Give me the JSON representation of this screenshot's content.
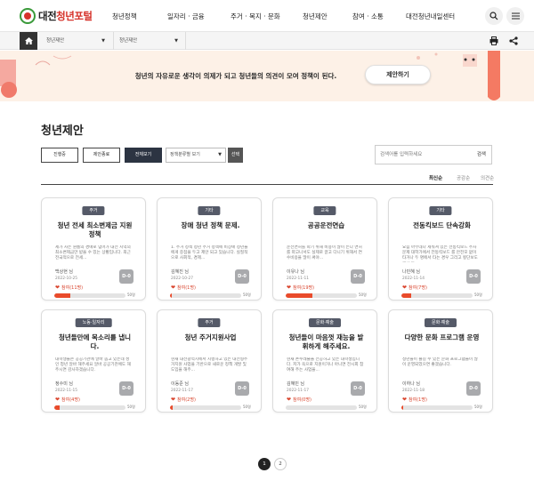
{
  "header": {
    "logo_prefix": "대전",
    "logo_main": "청년포털",
    "nav": [
      "청년정책",
      "일자리 · 금융",
      "주거 · 복지 · 문화",
      "청년제안",
      "참여 · 소통",
      "대전청년내일센터"
    ]
  },
  "breadcrumb": {
    "level1": "청년제안",
    "level2": "청년제안"
  },
  "banner": {
    "text": "청년의 자유로운 생각이 의제가 되고 청년들의 의견이 모여 정책이 된다.",
    "button_label": "제안하기"
  },
  "page_title": "청년제안",
  "filters": {
    "in_progress": "진행중",
    "closed": "제안종료",
    "view_all": "전체보기",
    "policy_select": "정책분류별 보기",
    "select_btn": "선택"
  },
  "search": {
    "placeholder": "검색어를 입력하세요",
    "button": "검색"
  },
  "sort": {
    "latest": "최신순",
    "likes": "공감순",
    "comments": "의견순"
  },
  "cards": [
    {
      "category": "주거",
      "title": "청년 전세 최소변제금 지원 정책",
      "desc": "제가 사는 원룸의 경매로 넘어가 대전 지역의 최소변제금만 받을 수 있는 상황입니다. 최근 전국적으로 전세...",
      "author": "백상현 님",
      "date": "2022-10-25",
      "dday": "D-0",
      "participants": "참여(11명)",
      "fill": 0.22,
      "goal": "50명"
    },
    {
      "category": "기타",
      "title": "장애 청년 정책 문제.",
      "desc": "1. 주거 정책 청년 주거 정책에 비장애 청년들에게 중점을 두고 제안 되고 있습니다. 실질적으로 사회적, 경제...",
      "author": "김혜진 님",
      "date": "2022-10-27",
      "dday": "D-0",
      "participants": "참여(1명)",
      "fill": 0.02,
      "goal": "50명"
    },
    {
      "category": "교육",
      "title": "공공운전연습",
      "desc": "운전면허를 따기 위해 비용이 많이 든다 면허를 따고나서도 실제로 끌고 다니기 위해서 연수비용을 많이 써야...",
      "author": "이유나 님",
      "date": "2022-11-11",
      "dday": "D-0",
      "participants": "참여(19명)",
      "fill": 0.38,
      "goal": "50명"
    },
    {
      "category": "기타",
      "title": "전동킥보드 단속강화",
      "desc": "요즘 아무데나 세워져 있는 전동킥보드 주차문제 대학가에서 전동킥보드 를 안전모 없이 타거나 두 명에서 타는 경우 그리고 횡단보도에서 통...",
      "author": "나민혜 님",
      "date": "2022-11-14",
      "dday": "D-0",
      "participants": "참여(7명)",
      "fill": 0.14,
      "goal": "50명"
    },
    {
      "category": "노동·일자리",
      "title": "청년들만에 목소리를 냅니다.",
      "desc": "대학생들은 공공기관에 알바 뽑고 있는데 성인 청년 알바 해주세요 알바 공공기관에도 해주시면 감사하겠습니다.",
      "author": "정수미 님",
      "date": "2022-11-15",
      "dday": "D-0",
      "participants": "참여(4명)",
      "fill": 0.08,
      "goal": "50명"
    },
    {
      "category": "주거",
      "title": "청년 주거지원사업",
      "desc": "현재 대전광역시에서 시행하고 있는 대전형주거지원 사업을 기반으로 새로운 정책 개발 및 도입을 해주...",
      "author": "이동준 님",
      "date": "2022-11-17",
      "dday": "D-0",
      "participants": "참여(2명)",
      "fill": 0.04,
      "goal": "50명"
    },
    {
      "category": "문화·예술",
      "title": "청년들이 마음껏 재능을 발휘하게 해주세요.",
      "desc": "현재 손수레술을 전공하고 있는 대학생입니다. 저가 옥으로 지원이거나 아니면 전시회 참여해 주는 사업을...",
      "author": "김혜민 님",
      "date": "2022-11-17",
      "dday": "D-0",
      "participants": "참여(0명)",
      "fill": 0.0,
      "goal": "50명"
    },
    {
      "category": "문화·예술",
      "title": "다양한 문화 프로그램 운영",
      "desc": "청년들이 즐길 수 있는 문화 프로그램들이 많이 운영되었으면 좋겠습니다.",
      "author": "이하나 님",
      "date": "2022-11-18",
      "dday": "D-0",
      "participants": "참여(1명)",
      "fill": 0.02,
      "goal": "50명"
    }
  ],
  "pagination": [
    "1",
    "2"
  ],
  "colors": {
    "accent": "#e94b2b",
    "badge": "#555a68",
    "banner_bg": "#fdf1e7",
    "logo_red": "#d6332b",
    "active_btn": "#2c3442"
  },
  "icons": {
    "search": "search-icon",
    "menu": "menu-icon",
    "home": "home-icon",
    "print": "print-icon",
    "share": "share-icon",
    "heart": "heart-icon"
  }
}
